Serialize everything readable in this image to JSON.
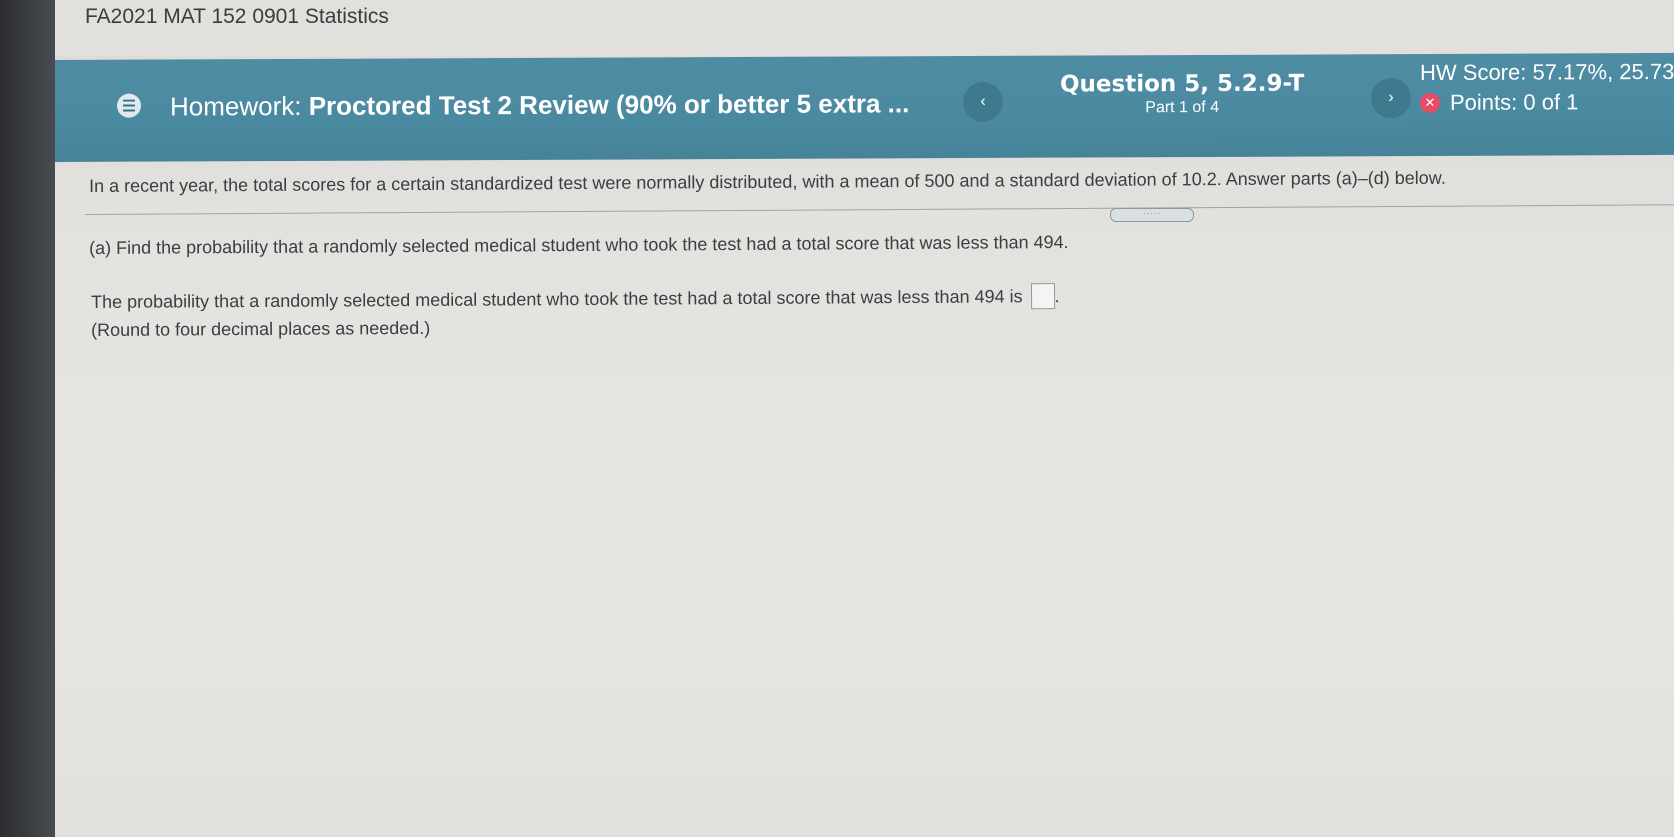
{
  "course": {
    "title": "FA2021 MAT 152 0901 Statistics"
  },
  "header": {
    "menu_icon": "menu-icon",
    "homework_prefix": "Homework:",
    "homework_title": "Proctored Test 2 Review (90% or better 5 extra ...",
    "prev_label": "‹",
    "next_label": "›",
    "question_title": "Question 5, 5.2.9-T",
    "question_part": "Part 1 of 4",
    "hw_score": "HW Score: 57.17%, 25.73",
    "points": "Points: 0 of 1",
    "points_status_icon": "incorrect-x-icon",
    "colors": {
      "header_bg": "#4a8aa0",
      "incorrect": "#e74c66"
    }
  },
  "question": {
    "intro": "In a recent year, the total scores for a certain standardized test were normally distributed, with a mean of 500 and a standard deviation of 10.2. Answer parts (a)–(d) below.",
    "divider_handle": "·····",
    "part_a": "(a) Find the probability that a randomly selected medical student who took the test had a total score that was less than 494.",
    "answer_prompt": "The probability that a randomly selected medical student who took the test had a total score that was less than 494 is",
    "answer_value": "",
    "answer_suffix": ".",
    "round_note": "(Round to four decimal places as needed.)"
  }
}
